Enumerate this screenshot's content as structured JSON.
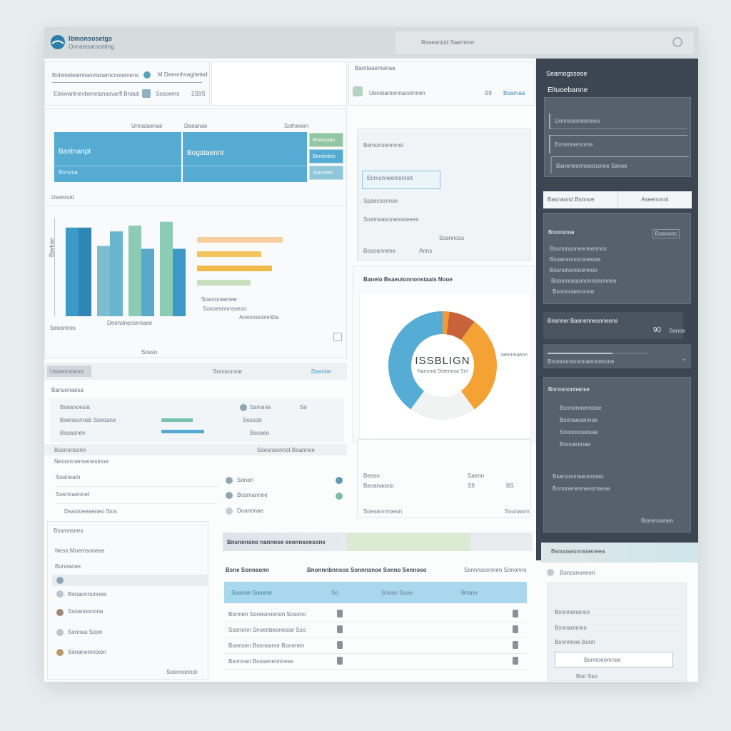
{
  "header": {
    "brand_title": "Ibmonsosetgs",
    "brand_subtitle": "Onnamsarnonting",
    "search_placeholder": "Reseaniod Saeminer"
  },
  "top_card": {
    "line1": "Bolwoeloienhanvtsnamcnonenens",
    "line1_value": "M Deeonhvagitetedi",
    "line2": "Eblovanlnevbenetanasvarfl Bnaubonne",
    "line2_btn": "Sosoems",
    "line2_value": "2S9S"
  },
  "mid_card": {
    "title": "Bamtaaemanaa",
    "row": "Uenetamennanoinnen",
    "value": "S9",
    "status": "Boarnaa"
  },
  "summary": {
    "col_labels": [
      "Unnataenae",
      "Daeanao",
      "Sotheoen"
    ],
    "cells": [
      "Bastnanpt",
      "Bogataennt",
      "Bonvsa"
    ],
    "side": [
      "Boansaan",
      "Bemiedno",
      "Sonneen"
    ]
  },
  "panel_right": {
    "rows": [
      "Bemonsemnnet",
      "Enmsnneenlsnnet",
      "Spaecsonnse",
      "Soetnaasonensoeees"
    ],
    "footer": [
      "Bosoannene",
      "Anns",
      "Sosnnoss"
    ]
  },
  "bar_section": {
    "label": "Usennoti",
    "axis_label": "Bavkae",
    "footer": "Sosso",
    "legend": [
      "Deendnonsnnaee",
      "Sosoesnnnsseoo",
      "Anenosoonntbs",
      "Seoonnes",
      "Soenoneenee"
    ]
  },
  "chart_data": [
    {
      "type": "bar",
      "values": [
        92,
        92,
        73,
        88,
        94,
        70,
        98,
        70
      ],
      "colors": [
        "#3d9ac7",
        "#2f86b3",
        "#7ebdd0",
        "#69b5cf",
        "#8ccbb5",
        "#5aa9c9",
        "#8ccbb5",
        "#3d9ac7"
      ]
    },
    {
      "type": "bar",
      "orientation": "horizontal",
      "values": [
        80,
        60,
        70,
        50
      ],
      "colors": [
        "#f6cfa1",
        "#f3c55a",
        "#f0b94a",
        "#c8e0bd"
      ]
    },
    {
      "type": "pie",
      "title": "Baneio Bsaeutonnonstaais Nooe",
      "center_value": "ISSBLIGN",
      "center_label": "Naeonat Dntenosa Sot",
      "slice_label": "Iaeoneaeon",
      "values": [
        40,
        2,
        8,
        30,
        20
      ],
      "colors": [
        "#55add6",
        "#f29a34",
        "#c8623a",
        "#f5a235",
        "#f1f2f2"
      ]
    }
  ],
  "filters": {
    "title": "Ussennotesn",
    "mid": "Sonounnoe",
    "link": "Dsenbe",
    "sub": "Banuenaesa"
  },
  "filter_rows": [
    [
      "Bsnanoesia",
      "Ssmane",
      "So"
    ],
    [
      "Boensonnsb Ssnoane",
      "Sossdo",
      ""
    ],
    [
      "Bsoasnen",
      "Bosaeo",
      ""
    ]
  ],
  "list_left": {
    "title": "Bsenonsomi",
    "right": "Soesnsonnot Boannoe",
    "rows": [
      "Soaneam",
      "Sosnnaeonet",
      "Dsanloeeaeneo Sios"
    ],
    "side": [
      "Sonon",
      "Bosmannee",
      "Doanonae"
    ],
    "sub": "Neoomnensenestnoe"
  },
  "right_mid": {
    "head": [
      "Beaso",
      "Saenn"
    ],
    "rows": [
      [
        "Beoanaoosr",
        "S9",
        "BS"
      ],
      [
        "Soesanrmoeon",
        "Sounaorn",
        ""
      ]
    ]
  },
  "people": {
    "title": "Bssmnsnes",
    "sub": "Nesn Moemsoneea",
    "section": "Bonnaoes",
    "items": [
      "Bonaonnonnee",
      "Ssoanoonona",
      "Sonnaa Soon",
      "Sonanemnoion"
    ],
    "footer": "Soennonnot"
  },
  "table": {
    "banner": "Bnsnonsno nannooe eeonnsoesone",
    "title": "Bsne Sonnsonn",
    "subtitle": "Bnonnnbnnsos Sonnnsnoe Sonno Sennoso",
    "right": "Ssnnnsoennen Sononno",
    "headers": [
      "Sosone Sonenn",
      "So",
      "Snoon Sooe",
      "Bnsnn"
    ],
    "rows": [
      "Bonnen Sonesnoonon Sosono",
      "Sosnonn Snoenbeoneose Sso",
      "Boensen Bsnnasnnr Bonenen",
      "Bsnnnan Bossenennnese"
    ]
  },
  "sidebar": {
    "title": "Seamogsseoe",
    "subtitle": "Eltuoebanne",
    "box_rows": [
      "Uonnnsonnoneeo",
      "Eonsnnennsne",
      "Banenesnnsesnsnee Ssnoe"
    ],
    "tabs": [
      "Basnannd Bsnnoe",
      "Aseenonnt"
    ],
    "list_title": "Bnononoe",
    "list_value": "Boanonc",
    "list": [
      "Bnsnonsoneennennos",
      "Bsoansnnonooeooe",
      "Bosnonsnonennoo",
      "Boomnoeaononnseonnee",
      "Bsnonnaenonoe"
    ],
    "stat_title": "Bnsnner Basnennesnneons",
    "stat_value": "90",
    "stat_label": "Senoe",
    "progress_label": "Bnonnonsnonnannnesone",
    "progress": 0.65,
    "sub_title": "Bnnnsnonnanse",
    "sub_items": [
      "Bsnnonnennoae",
      "Bsnnaesennoe",
      "Snoonnoansae",
      "Bnnoemnae",
      "Bsanonnnaeonnneo",
      "Bnnonenenneoonseoe"
    ],
    "sub_footer": "Bonenoonen"
  },
  "bottom_right": {
    "banner": "Bsnnoseonnsneneea",
    "title": "Bonosnoeeen",
    "rows": [
      "Bsnnnonsneo",
      "Bsnnaonnen",
      "Bsnnnnoe Bsnn",
      "Bonnoeomnse"
    ],
    "footer": "Bsn Sso"
  }
}
